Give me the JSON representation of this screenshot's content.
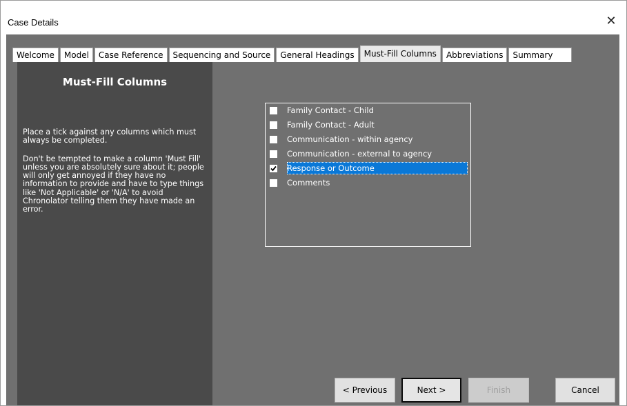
{
  "window": {
    "title": "Case Details",
    "close_label": "✕"
  },
  "tabs": [
    {
      "label": "Welcome"
    },
    {
      "label": "Model"
    },
    {
      "label": "Case Reference"
    },
    {
      "label": "Sequencing and Source"
    },
    {
      "label": "General Headings"
    },
    {
      "label": "Must-Fill Columns",
      "active": true
    },
    {
      "label": "Abbreviations"
    },
    {
      "label": "Summary"
    }
  ],
  "panel": {
    "heading": "Must-Fill Columns",
    "paragraph1": "Place a tick against any columns which must always be completed.",
    "paragraph2": "Don't be tempted to make a column 'Must Fill' unless you are absolutely sure about it; people will only get annoyed if they have no information to provide and have to type things like 'Not Applicable' or 'N/A' to avoid Chronolator telling them they have made an error."
  },
  "columns": [
    {
      "label": "Family Contact - Child",
      "checked": false
    },
    {
      "label": "Family Contact - Adult",
      "checked": false
    },
    {
      "label": "Communication - within agency",
      "checked": false
    },
    {
      "label": "Communication - external to agency",
      "checked": false
    },
    {
      "label": "Response or Outcome",
      "checked": true,
      "selected": true
    },
    {
      "label": "Comments",
      "checked": false
    }
  ],
  "buttons": {
    "previous": "< Previous",
    "next": "Next >",
    "finish": "Finish",
    "cancel": "Cancel"
  },
  "colors": {
    "client_bg": "#707070",
    "panel_bg": "#4a4a4a",
    "selection": "#0a78d7"
  }
}
